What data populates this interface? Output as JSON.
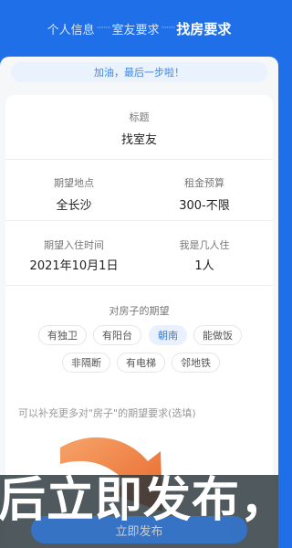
{
  "steps": [
    "个人信息",
    "室友要求",
    "找房要求"
  ],
  "step_divider": "········",
  "tip": "加油，最后一步啦！",
  "title_field": {
    "label": "标题",
    "value": "找室友"
  },
  "location": {
    "label": "期望地点",
    "value": "全长沙"
  },
  "budget": {
    "label": "租金预算",
    "value": "300-不限"
  },
  "move_in": {
    "label": "期望入住时间",
    "value": "2021年10月1日"
  },
  "occupants": {
    "label": "我是几人住",
    "value": "1人"
  },
  "expectations": {
    "label": "对房子的期望",
    "tags": [
      "有独卫",
      "有阳台",
      "朝南",
      "能做饭",
      "非隔断",
      "有电梯",
      "邻地铁"
    ],
    "selected": "朝南"
  },
  "extra_placeholder": "可以补充更多对\"房子\"的期望要求(选填)",
  "publish_label": "立即发布",
  "overlay_caption": "后立即发布，",
  "colors": {
    "brand": "#1e6fe8",
    "accent": "#2f7fe6",
    "arrow": "#f08a3c"
  }
}
